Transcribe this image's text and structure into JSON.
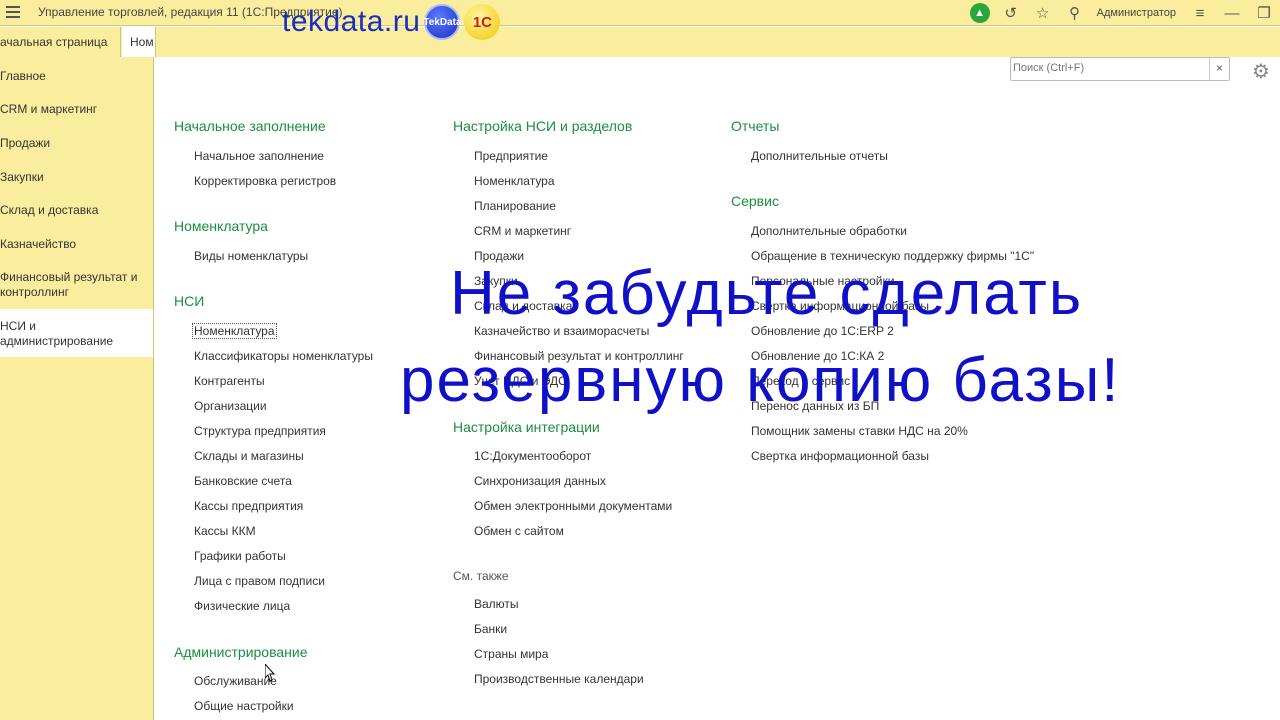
{
  "titlebar": {
    "app_title": "Управление торговлей, редакция 11  (1С:Предприятие)",
    "user": "Администратор"
  },
  "watermark": {
    "site": "tekdata.ru",
    "badge1": "TekData",
    "badge2": "1С"
  },
  "tabs": [
    {
      "label": "ачальная страница"
    },
    {
      "label": "Ном"
    }
  ],
  "sidebar": {
    "items": [
      {
        "label": "Главное"
      },
      {
        "label": "CRM и маркетинг"
      },
      {
        "label": "Продажи"
      },
      {
        "label": "Закупки"
      },
      {
        "label": "Склад и доставка"
      },
      {
        "label": "Казначейство"
      },
      {
        "label": "Финансовый результат и контроллинг"
      },
      {
        "label": "НСИ и администрирование"
      }
    ]
  },
  "search": {
    "placeholder": "Поиск (Ctrl+F)",
    "clear": "×"
  },
  "col1": {
    "s1": {
      "title": "Начальное заполнение",
      "links": [
        "Начальное заполнение",
        "Корректировка регистров"
      ]
    },
    "s2": {
      "title": "Номенклатура",
      "links": [
        "Виды номенклатуры"
      ]
    },
    "s3": {
      "title": "НСИ",
      "links": [
        "Номенклатура",
        "Классификаторы номенклатуры",
        "Контрагенты",
        "Организации",
        "Структура предприятия",
        "Склады и магазины",
        "Банковские счета",
        "Кассы предприятия",
        "Кассы ККМ",
        "Графики работы",
        "Лица с правом подписи",
        "Физические лица"
      ]
    },
    "s4": {
      "title": "Администрирование",
      "links": [
        "Обслуживание",
        "Общие настройки"
      ]
    }
  },
  "col2": {
    "s1": {
      "title": "Настройка НСИ и разделов",
      "links": [
        "Предприятие",
        "Номенклатура",
        "Планирование",
        "CRM и маркетинг",
        "Продажи",
        "Закупки",
        "Склад и доставка",
        "Казначейство и взаиморасчеты",
        "Финансовый результат и контроллинг",
        "Учет НДС и ЭДО"
      ]
    },
    "s2": {
      "title": "Настройка интеграции",
      "links": [
        "1С:Документооборот",
        "Синхронизация данных",
        "Обмен электронными документами",
        "Обмен с сайтом"
      ]
    },
    "see_also": {
      "title": "См. также",
      "links": [
        "Валюты",
        "Банки",
        "Страны мира",
        "Производственные календари"
      ]
    }
  },
  "col3": {
    "s1": {
      "title": "Отчеты",
      "links": [
        "Дополнительные отчеты"
      ]
    },
    "s2": {
      "title": "Сервис",
      "links": [
        "Дополнительные обработки",
        "Обращение в техническую поддержку фирмы \"1С\"",
        "Персональные настройки",
        "Свертка информационной базы",
        "Обновление до 1С:ERP 2",
        "Обновление до 1С:КА 2",
        "Переход в сервис",
        "Перенос данных из БП",
        "Помощник замены ставки НДС на 20%",
        "Свертка информационной базы"
      ]
    }
  },
  "banner": {
    "line1": "Не забудьте сделать",
    "line2": "резервную копию базы!"
  }
}
